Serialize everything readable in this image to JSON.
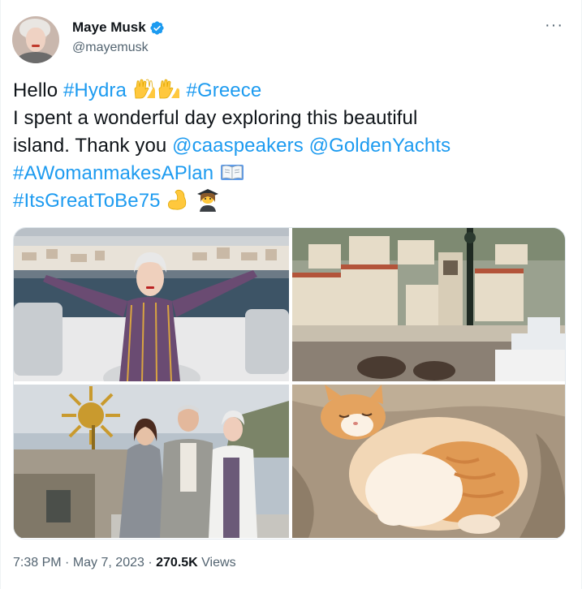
{
  "author": {
    "display_name": "Maye Musk",
    "handle": "@mayemusk",
    "verified": true
  },
  "tweet": {
    "line1": {
      "word": "Hello",
      "tag1": "#Hydra",
      "tag2": "#Greece"
    },
    "line2": "I spent a wonderful day exploring this beautiful",
    "line3": {
      "text": "island. Thank you",
      "mention1": "@caaspeakers",
      "mention2": "@GoldenYachts"
    },
    "line4": {
      "tag": "#AWomanmakesAPlan"
    },
    "line5": {
      "tag": "#ItsGreatToBe75"
    }
  },
  "media": {
    "photos": [
      {
        "subject": "woman-on-yacht"
      },
      {
        "subject": "hydra-harbor"
      },
      {
        "subject": "family-group"
      },
      {
        "subject": "sleeping-cat"
      }
    ]
  },
  "footer": {
    "time": "7:38 PM",
    "separator": "·",
    "date": "May 7, 2023",
    "views_count": "270.5K",
    "views_label": "Views"
  },
  "icons": {
    "verified": "verified-badge-icon",
    "more": "more-options-icon"
  },
  "colors": {
    "link": "#1d9bf0",
    "text": "#0f1419",
    "secondary": "#536471"
  }
}
